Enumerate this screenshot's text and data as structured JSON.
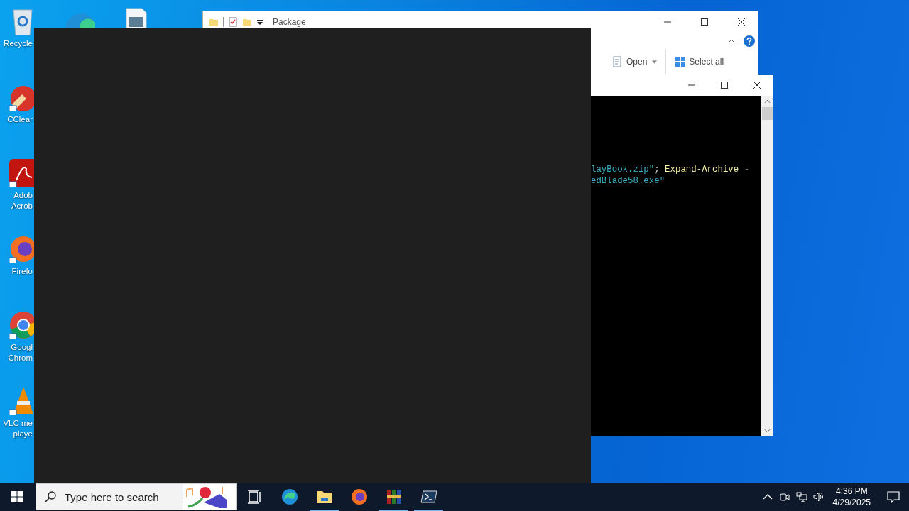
{
  "desktop_icons": [
    {
      "kind": "recyclebin",
      "lines": [
        "Recycle"
      ]
    },
    {
      "kind": "ccleaner",
      "lines": [
        "CClear"
      ]
    },
    {
      "kind": "acrobat",
      "lines": [
        "Adob",
        "Acrob"
      ]
    },
    {
      "kind": "firefox",
      "lines": [
        "Firefo"
      ]
    },
    {
      "kind": "chrome",
      "lines": [
        "Googl",
        "Chrom"
      ]
    },
    {
      "kind": "vlc",
      "lines": [
        "VLC me",
        "playe"
      ]
    }
  ],
  "explorer": {
    "title": "Package",
    "ribbon": [
      {
        "label": "Open",
        "dropdown": true
      },
      {
        "label": "Select all",
        "dropdown": false
      }
    ]
  },
  "console": {
    "lines": [
      [
        {
          "text": "layBook.zip\"",
          "kind": "string"
        },
        {
          "text": "; ",
          "kind": "operator"
        },
        {
          "text": "Expand-Archive",
          "kind": "command"
        },
        {
          "text": " -",
          "kind": "parameter"
        }
      ],
      [
        {
          "text": "edBlade58.exe\"",
          "kind": "string"
        }
      ]
    ]
  },
  "taskbar": {
    "search": {
      "placeholder": "Type here to search"
    },
    "apps": [
      {
        "kind": "taskview",
        "running": false
      },
      {
        "kind": "edge",
        "running": false
      },
      {
        "kind": "explorer",
        "running": true
      },
      {
        "kind": "firefox",
        "running": false
      },
      {
        "kind": "winrar",
        "running": true
      },
      {
        "kind": "terminal",
        "running": true
      }
    ],
    "clock": {
      "time": "4:36 PM",
      "date": "4/29/2025"
    }
  }
}
